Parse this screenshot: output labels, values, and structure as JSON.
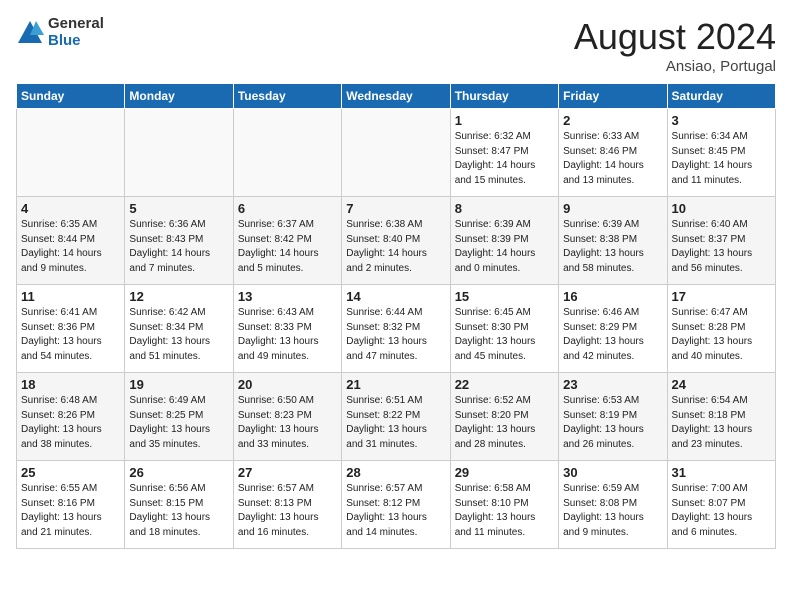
{
  "header": {
    "logo_general": "General",
    "logo_blue": "Blue",
    "month_title": "August 2024",
    "subtitle": "Ansiao, Portugal"
  },
  "days_of_week": [
    "Sunday",
    "Monday",
    "Tuesday",
    "Wednesday",
    "Thursday",
    "Friday",
    "Saturday"
  ],
  "weeks": [
    [
      {
        "day": "",
        "info": ""
      },
      {
        "day": "",
        "info": ""
      },
      {
        "day": "",
        "info": ""
      },
      {
        "day": "",
        "info": ""
      },
      {
        "day": "1",
        "info": "Sunrise: 6:32 AM\nSunset: 8:47 PM\nDaylight: 14 hours\nand 15 minutes."
      },
      {
        "day": "2",
        "info": "Sunrise: 6:33 AM\nSunset: 8:46 PM\nDaylight: 14 hours\nand 13 minutes."
      },
      {
        "day": "3",
        "info": "Sunrise: 6:34 AM\nSunset: 8:45 PM\nDaylight: 14 hours\nand 11 minutes."
      }
    ],
    [
      {
        "day": "4",
        "info": "Sunrise: 6:35 AM\nSunset: 8:44 PM\nDaylight: 14 hours\nand 9 minutes."
      },
      {
        "day": "5",
        "info": "Sunrise: 6:36 AM\nSunset: 8:43 PM\nDaylight: 14 hours\nand 7 minutes."
      },
      {
        "day": "6",
        "info": "Sunrise: 6:37 AM\nSunset: 8:42 PM\nDaylight: 14 hours\nand 5 minutes."
      },
      {
        "day": "7",
        "info": "Sunrise: 6:38 AM\nSunset: 8:40 PM\nDaylight: 14 hours\nand 2 minutes."
      },
      {
        "day": "8",
        "info": "Sunrise: 6:39 AM\nSunset: 8:39 PM\nDaylight: 14 hours\nand 0 minutes."
      },
      {
        "day": "9",
        "info": "Sunrise: 6:39 AM\nSunset: 8:38 PM\nDaylight: 13 hours\nand 58 minutes."
      },
      {
        "day": "10",
        "info": "Sunrise: 6:40 AM\nSunset: 8:37 PM\nDaylight: 13 hours\nand 56 minutes."
      }
    ],
    [
      {
        "day": "11",
        "info": "Sunrise: 6:41 AM\nSunset: 8:36 PM\nDaylight: 13 hours\nand 54 minutes."
      },
      {
        "day": "12",
        "info": "Sunrise: 6:42 AM\nSunset: 8:34 PM\nDaylight: 13 hours\nand 51 minutes."
      },
      {
        "day": "13",
        "info": "Sunrise: 6:43 AM\nSunset: 8:33 PM\nDaylight: 13 hours\nand 49 minutes."
      },
      {
        "day": "14",
        "info": "Sunrise: 6:44 AM\nSunset: 8:32 PM\nDaylight: 13 hours\nand 47 minutes."
      },
      {
        "day": "15",
        "info": "Sunrise: 6:45 AM\nSunset: 8:30 PM\nDaylight: 13 hours\nand 45 minutes."
      },
      {
        "day": "16",
        "info": "Sunrise: 6:46 AM\nSunset: 8:29 PM\nDaylight: 13 hours\nand 42 minutes."
      },
      {
        "day": "17",
        "info": "Sunrise: 6:47 AM\nSunset: 8:28 PM\nDaylight: 13 hours\nand 40 minutes."
      }
    ],
    [
      {
        "day": "18",
        "info": "Sunrise: 6:48 AM\nSunset: 8:26 PM\nDaylight: 13 hours\nand 38 minutes."
      },
      {
        "day": "19",
        "info": "Sunrise: 6:49 AM\nSunset: 8:25 PM\nDaylight: 13 hours\nand 35 minutes."
      },
      {
        "day": "20",
        "info": "Sunrise: 6:50 AM\nSunset: 8:23 PM\nDaylight: 13 hours\nand 33 minutes."
      },
      {
        "day": "21",
        "info": "Sunrise: 6:51 AM\nSunset: 8:22 PM\nDaylight: 13 hours\nand 31 minutes."
      },
      {
        "day": "22",
        "info": "Sunrise: 6:52 AM\nSunset: 8:20 PM\nDaylight: 13 hours\nand 28 minutes."
      },
      {
        "day": "23",
        "info": "Sunrise: 6:53 AM\nSunset: 8:19 PM\nDaylight: 13 hours\nand 26 minutes."
      },
      {
        "day": "24",
        "info": "Sunrise: 6:54 AM\nSunset: 8:18 PM\nDaylight: 13 hours\nand 23 minutes."
      }
    ],
    [
      {
        "day": "25",
        "info": "Sunrise: 6:55 AM\nSunset: 8:16 PM\nDaylight: 13 hours\nand 21 minutes."
      },
      {
        "day": "26",
        "info": "Sunrise: 6:56 AM\nSunset: 8:15 PM\nDaylight: 13 hours\nand 18 minutes."
      },
      {
        "day": "27",
        "info": "Sunrise: 6:57 AM\nSunset: 8:13 PM\nDaylight: 13 hours\nand 16 minutes."
      },
      {
        "day": "28",
        "info": "Sunrise: 6:57 AM\nSunset: 8:12 PM\nDaylight: 13 hours\nand 14 minutes."
      },
      {
        "day": "29",
        "info": "Sunrise: 6:58 AM\nSunset: 8:10 PM\nDaylight: 13 hours\nand 11 minutes."
      },
      {
        "day": "30",
        "info": "Sunrise: 6:59 AM\nSunset: 8:08 PM\nDaylight: 13 hours\nand 9 minutes."
      },
      {
        "day": "31",
        "info": "Sunrise: 7:00 AM\nSunset: 8:07 PM\nDaylight: 13 hours\nand 6 minutes."
      }
    ]
  ]
}
